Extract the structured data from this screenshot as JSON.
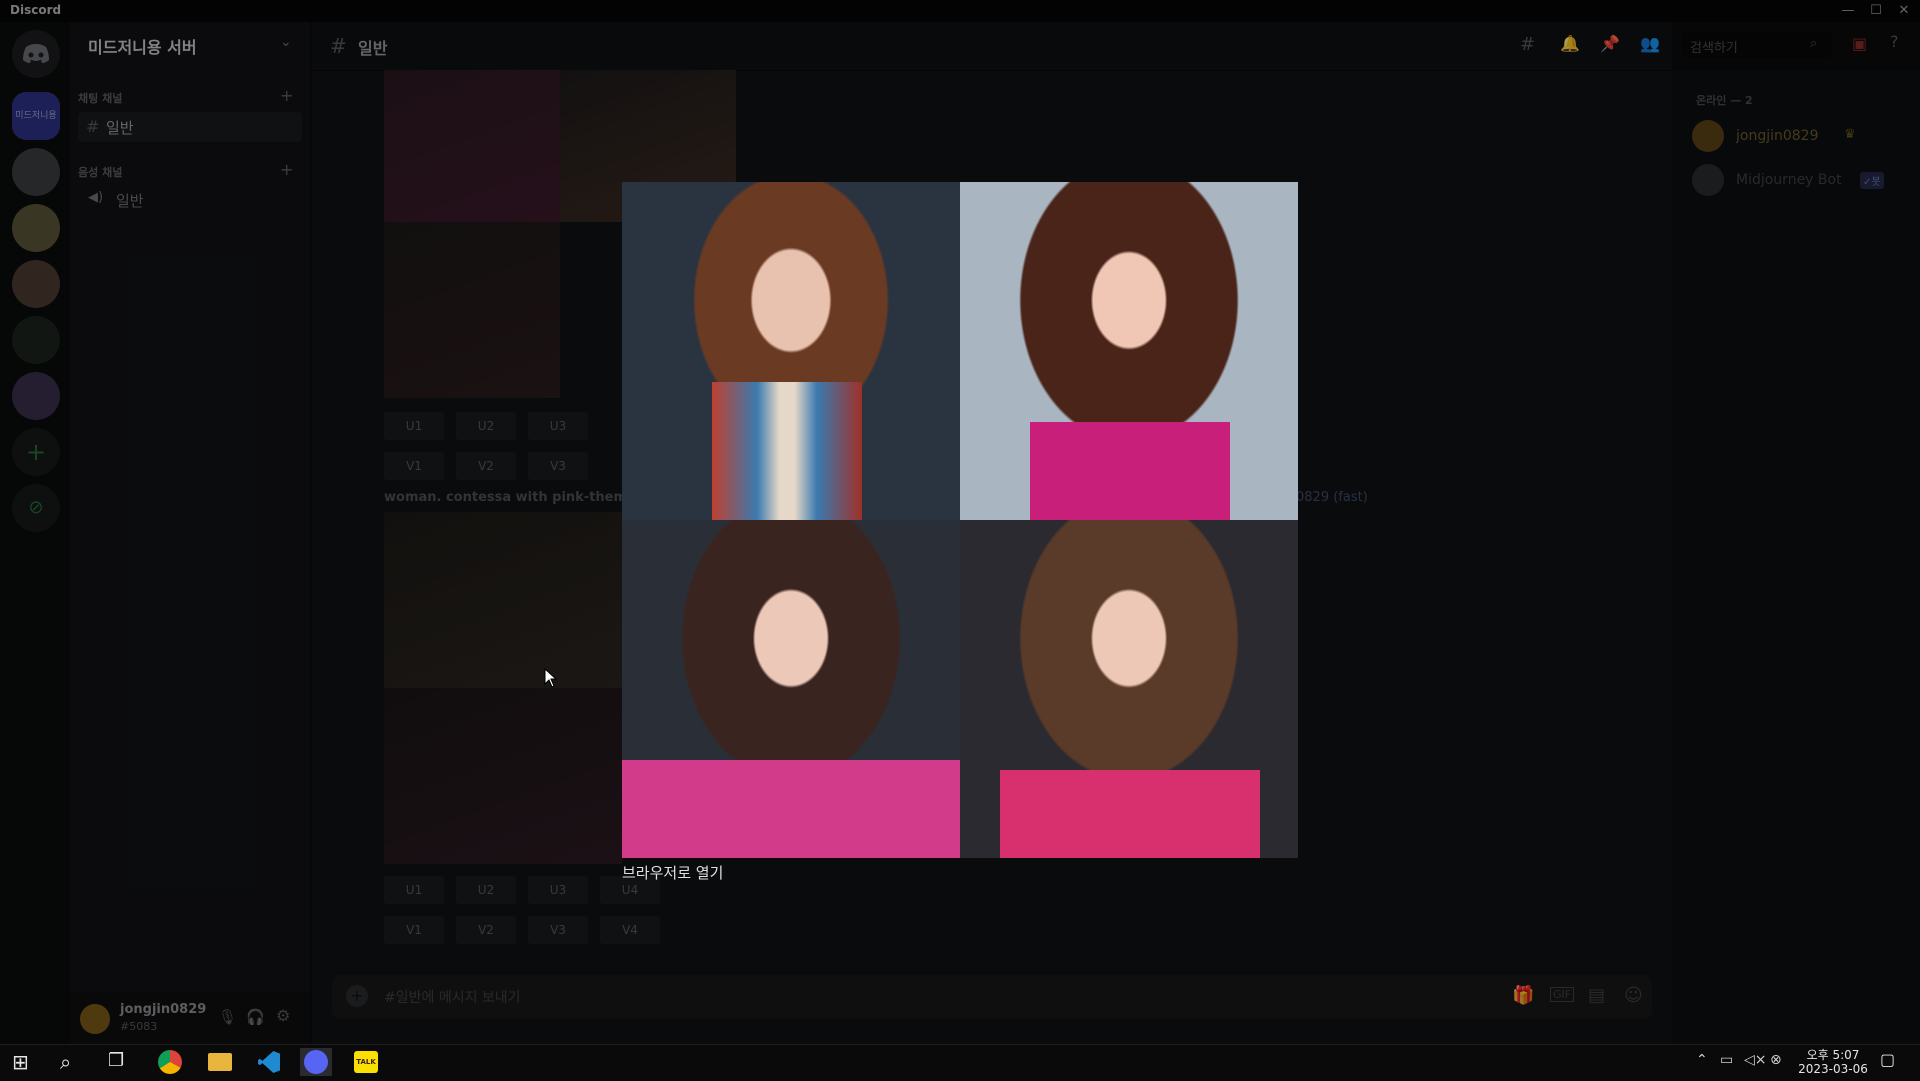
{
  "window": {
    "app_title": "Discord",
    "minimize": "—",
    "maximize": "☐",
    "close": "✕"
  },
  "server": {
    "name": "미드저니용 서버",
    "icon_label": "미드저니용서"
  },
  "sidebar": {
    "text_category": "채팅 채널",
    "text_channel": "일반",
    "voice_category": "음성 채널",
    "voice_channel": "일반"
  },
  "header": {
    "channel": "일반",
    "search_placeholder": "검색하기"
  },
  "messages": {
    "prompt_snippet": "woman. contessa with pink-theme",
    "prompt_tail": "0829 (fast)",
    "buttons_row1": [
      "U1",
      "U2",
      "U3"
    ],
    "buttons_row2": [
      "V1",
      "V2",
      "V3"
    ],
    "buttons_row3": [
      "U1",
      "U2",
      "U3",
      "U4"
    ],
    "buttons_row4": [
      "V1",
      "V2",
      "V3",
      "V4"
    ]
  },
  "members": {
    "online_header": "온라인 — 2",
    "list": [
      {
        "name": "jongjin0829",
        "badge": "♛"
      },
      {
        "name": "Midjourney Bot",
        "badge": "✓봇"
      }
    ]
  },
  "composer": {
    "placeholder": "#일반에 메시지 보내기"
  },
  "user": {
    "name": "jongjin0829",
    "tag": "#5083"
  },
  "overlay": {
    "open_in_browser": "브라우저로 열기"
  },
  "taskbar": {
    "time": "오후 5:07",
    "date": "2023-03-06"
  },
  "colors": {
    "accent": "#5865f2",
    "bg": "#0b0c0d",
    "online": "#3ba55c"
  }
}
